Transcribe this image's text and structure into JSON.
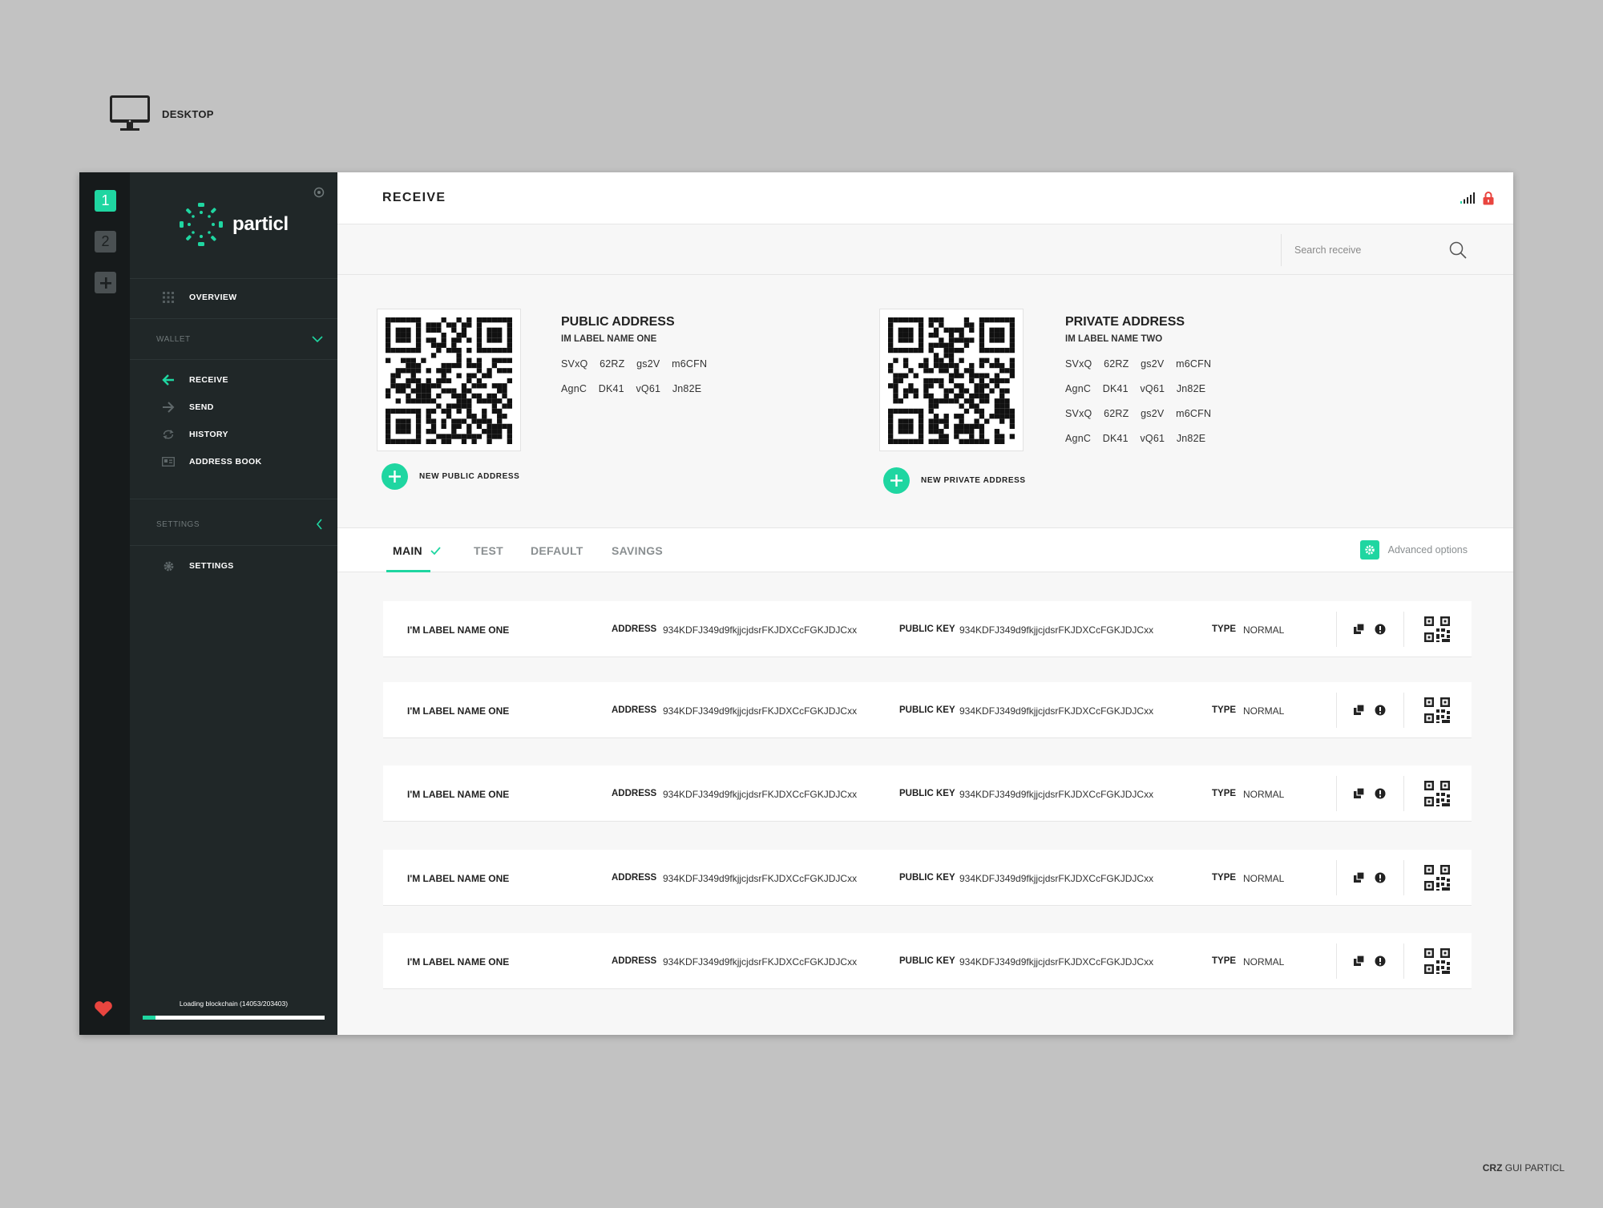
{
  "device_label": "DESKTOP",
  "credit": {
    "bold": "CRZ",
    "rest": " GUI PARTICL"
  },
  "colors": {
    "accent": "#1fd6a1",
    "sidebar": "#202728",
    "rail": "#161a1b",
    "lock": "#e9453f"
  },
  "rail": {
    "wallets": [
      "1",
      "2"
    ],
    "add_icon": "plus-icon",
    "footer_icon": "heart-icon"
  },
  "sidebar": {
    "logo_text": "particl",
    "overview": "OVERVIEW",
    "wallet_group": "WALLET",
    "wallet_items": [
      {
        "label": "RECEIVE",
        "icon": "arrow-left-icon"
      },
      {
        "label": "SEND",
        "icon": "arrow-right-icon"
      },
      {
        "label": "HISTORY",
        "icon": "refresh-icon"
      },
      {
        "label": "ADDRESS BOOK",
        "icon": "address-card-icon"
      }
    ],
    "settings_group": "SETTINGS",
    "settings_item": "SETTINGS",
    "loading_text": "Loading blockchain (14053/203403)",
    "loading_progress": 0.069
  },
  "header": {
    "title": "RECEIVE",
    "signal_icon": "signal-icon",
    "lock_icon": "lock-icon"
  },
  "search": {
    "placeholder": "Search receive",
    "value": ""
  },
  "public_address": {
    "title": "PUBLIC ADDRESS",
    "label": "IM LABEL NAME ONE",
    "lines": [
      "SVxQ 62RZ gs2V m6CFN",
      "AgnC DK41 vQ61 Jn82E"
    ],
    "button": "NEW PUBLIC ADDRESS"
  },
  "private_address": {
    "title": "PRIVATE ADDRESS",
    "label": "IM LABEL NAME TWO",
    "lines": [
      "SVxQ 62RZ gs2V m6CFN",
      "AgnC DK41 vQ61 Jn82E",
      "SVxQ 62RZ gs2V m6CFN",
      "AgnC DK41 vQ61 Jn82E"
    ],
    "button": "NEW PRIVATE ADDRESS"
  },
  "tabs": [
    {
      "label": "MAIN"
    },
    {
      "label": "TEST"
    },
    {
      "label": "DEFAULT"
    },
    {
      "label": "SAVINGS"
    }
  ],
  "advanced_options": "Advanced options",
  "columns": {
    "address": "ADDRESS",
    "public_key": "PUBLIC KEY",
    "type": "TYPE"
  },
  "rows": [
    {
      "label": "I'M LABEL NAME ONE",
      "address": "934KDFJ349d9fkjjcjdsrFKJDXCcFGKJDJCxx",
      "public_key": "934KDFJ349d9fkjjcjdsrFKJDXCcFGKJDJCxx",
      "type": "NORMAL"
    },
    {
      "label": "I'M LABEL NAME ONE",
      "address": "934KDFJ349d9fkjjcjdsrFKJDXCcFGKJDJCxx",
      "public_key": "934KDFJ349d9fkjjcjdsrFKJDXCcFGKJDJCxx",
      "type": "NORMAL"
    },
    {
      "label": "I'M LABEL NAME ONE",
      "address": "934KDFJ349d9fkjjcjdsrFKJDXCcFGKJDJCxx",
      "public_key": "934KDFJ349d9fkjjcjdsrFKJDXCcFGKJDJCxx",
      "type": "NORMAL"
    },
    {
      "label": "I'M LABEL NAME ONE",
      "address": "934KDFJ349d9fkjjcjdsrFKJDXCcFGKJDJCxx",
      "public_key": "934KDFJ349d9fkjjcjdsrFKJDXCcFGKJDJCxx",
      "type": "NORMAL"
    },
    {
      "label": "I'M LABEL NAME ONE",
      "address": "934KDFJ349d9fkjjcjdsrFKJDXCcFGKJDJCxx",
      "public_key": "934KDFJ349d9fkjjcjdsrFKJDXCcFGKJDJCxx",
      "type": "NORMAL"
    }
  ]
}
